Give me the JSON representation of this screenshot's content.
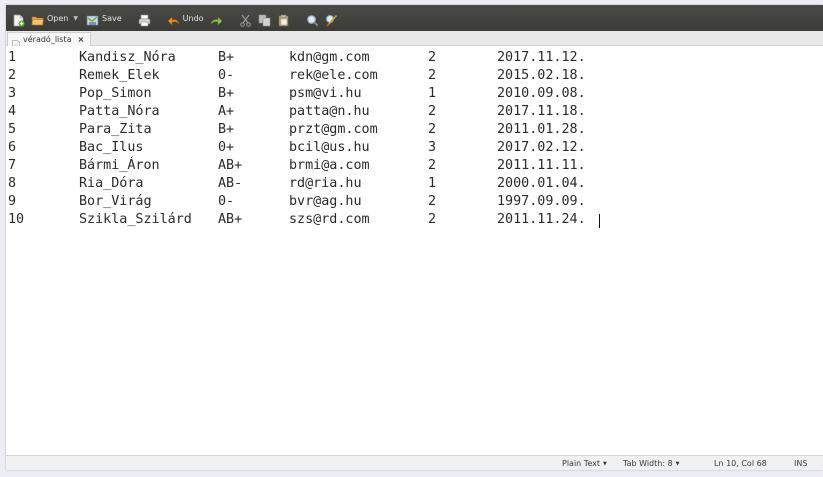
{
  "toolbar": {
    "open_label": "Open",
    "save_label": "Save",
    "undo_label": "Undo"
  },
  "tab": {
    "label": "véradó_lista",
    "close": "×"
  },
  "editor": {
    "rows": [
      [
        "1",
        "Kandisz_Nóra",
        "B+",
        "kdn@gm.com",
        "2",
        "2017.11.12."
      ],
      [
        "2",
        "Remek_Elek",
        "0-",
        "rek@ele.com",
        "2",
        "2015.02.18."
      ],
      [
        "3",
        "Pop_Simon",
        "B+",
        "psm@vi.hu",
        "1",
        "2010.09.08."
      ],
      [
        "4",
        "Patta_Nóra",
        "A+",
        "patta@n.hu",
        "2",
        "2017.11.18."
      ],
      [
        "5",
        "Para_Zita",
        "B+",
        "przt@gm.com",
        "2",
        "2011.01.28."
      ],
      [
        "6",
        "Bac_Ilus",
        "0+",
        "bcil@us.hu",
        "3",
        "2017.02.12."
      ],
      [
        "7",
        "Bármi_Áron",
        "AB+",
        "brmi@a.com",
        "2",
        "2011.11.11."
      ],
      [
        "8",
        "Ria_Dóra",
        "AB-",
        "rd@ria.hu",
        "1",
        "2000.01.04."
      ],
      [
        "9",
        "Bor_Virág",
        "0-",
        "bvr@ag.hu",
        "2",
        "1997.09.09."
      ],
      [
        "10",
        "Szikla_Szilárd",
        "AB+",
        "szs@rd.com",
        "2",
        "2011.11.24."
      ]
    ]
  },
  "statusbar": {
    "language": "Plain Text",
    "tab_width": "Tab Width: 8",
    "position": "Ln 10, Col 68",
    "mode": "INS"
  },
  "icons": {
    "new": "new-document-icon",
    "open": "folder-open-icon",
    "save": "save-icon",
    "print": "printer-icon",
    "undo": "undo-icon",
    "redo": "redo-icon",
    "cut": "scissors-icon",
    "copy": "copy-icon",
    "paste": "paste-icon",
    "find": "magnifier-icon",
    "replace": "find-replace-icon"
  },
  "colors": {
    "toolbar_bg": "#3f3f3c",
    "accent_orange": "#e8772e",
    "undo_orange": "#f08a1d",
    "text": "#2a2a2a"
  }
}
